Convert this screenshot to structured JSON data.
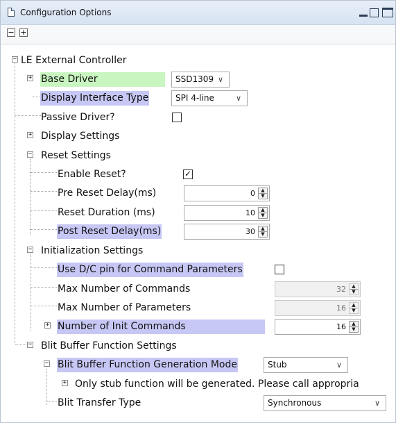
{
  "window": {
    "title": "Configuration Options",
    "icon": "document-icon"
  },
  "toolbar": {
    "collapse_all": "−",
    "expand_all": "+"
  },
  "tree": {
    "root_label": "LE External Controller",
    "base_driver": {
      "label": "Base Driver",
      "value": "SSD1309"
    },
    "display_interface": {
      "label": "Display Interface Type",
      "value": "SPI 4-line"
    },
    "passive_driver": {
      "label": "Passive Driver?",
      "checked": false
    },
    "display_settings": {
      "label": "Display Settings"
    },
    "reset_settings": {
      "label": "Reset Settings",
      "enable_reset": {
        "label": "Enable Reset?",
        "checked": true,
        "mark": "✓"
      },
      "pre_reset_delay": {
        "label": "Pre Reset Delay(ms)",
        "value": "0"
      },
      "reset_duration": {
        "label": "Reset Duration (ms)",
        "value": "10"
      },
      "post_reset_delay": {
        "label": "Post Reset Delay(ms)",
        "value": "30"
      }
    },
    "init_settings": {
      "label": "Initialization Settings",
      "use_dc_pin": {
        "label": "Use D/C pin for Command Parameters",
        "checked": false
      },
      "max_commands": {
        "label": "Max Number of Commands",
        "value": "32"
      },
      "max_parameters": {
        "label": "Max Number of Parameters",
        "value": "16"
      },
      "num_init_commands": {
        "label": "Number of Init Commands",
        "value": "16"
      }
    },
    "blit_settings": {
      "label": "Blit Buffer Function Settings",
      "generation_mode": {
        "label": "Blit Buffer Function Generation Mode",
        "value": "Stub"
      },
      "stub_note": "Only stub function will be generated. Please call appropria",
      "transfer_type": {
        "label": "Blit Transfer Type",
        "value": "Synchronous"
      }
    }
  },
  "colors": {
    "highlight_blue": "#c7c7f5",
    "highlight_green": "#c9f5c1",
    "title_bar": "#d7e3f2"
  }
}
